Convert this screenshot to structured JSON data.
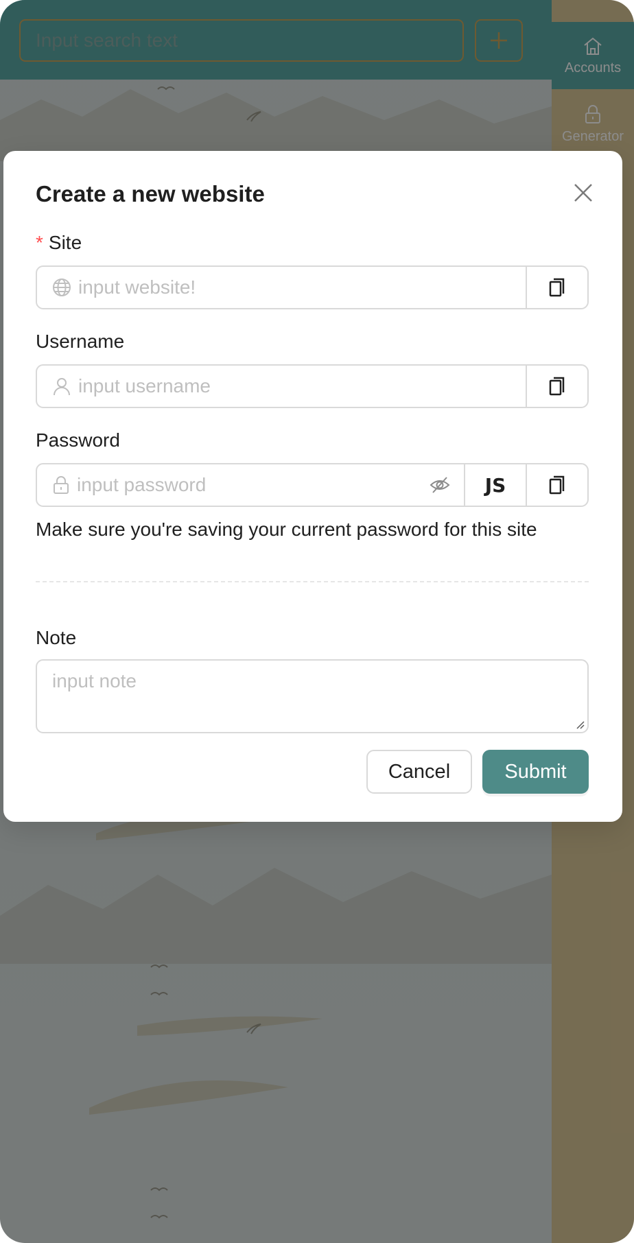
{
  "topbar": {
    "search_placeholder": "Input search text"
  },
  "sidebar": {
    "items": [
      {
        "label": "Accounts",
        "icon": "home-icon",
        "active": true
      },
      {
        "label": "Generator",
        "icon": "lock-icon",
        "active": false
      }
    ]
  },
  "modal": {
    "title": "Create a new website",
    "site": {
      "label": "Site",
      "required_mark": "*",
      "placeholder": "input website!"
    },
    "username": {
      "label": "Username",
      "placeholder": "input username"
    },
    "password": {
      "label": "Password",
      "placeholder": "input password",
      "js_label": "JS"
    },
    "hint": "Make sure you're saving your current password for this site",
    "note": {
      "label": "Note",
      "placeholder": "input note"
    },
    "buttons": {
      "cancel": "Cancel",
      "submit": "Submit"
    }
  },
  "colors": {
    "primary": "#4e8b88",
    "sidebar_bg": "#d8c596",
    "required": "#ff4d4f"
  }
}
